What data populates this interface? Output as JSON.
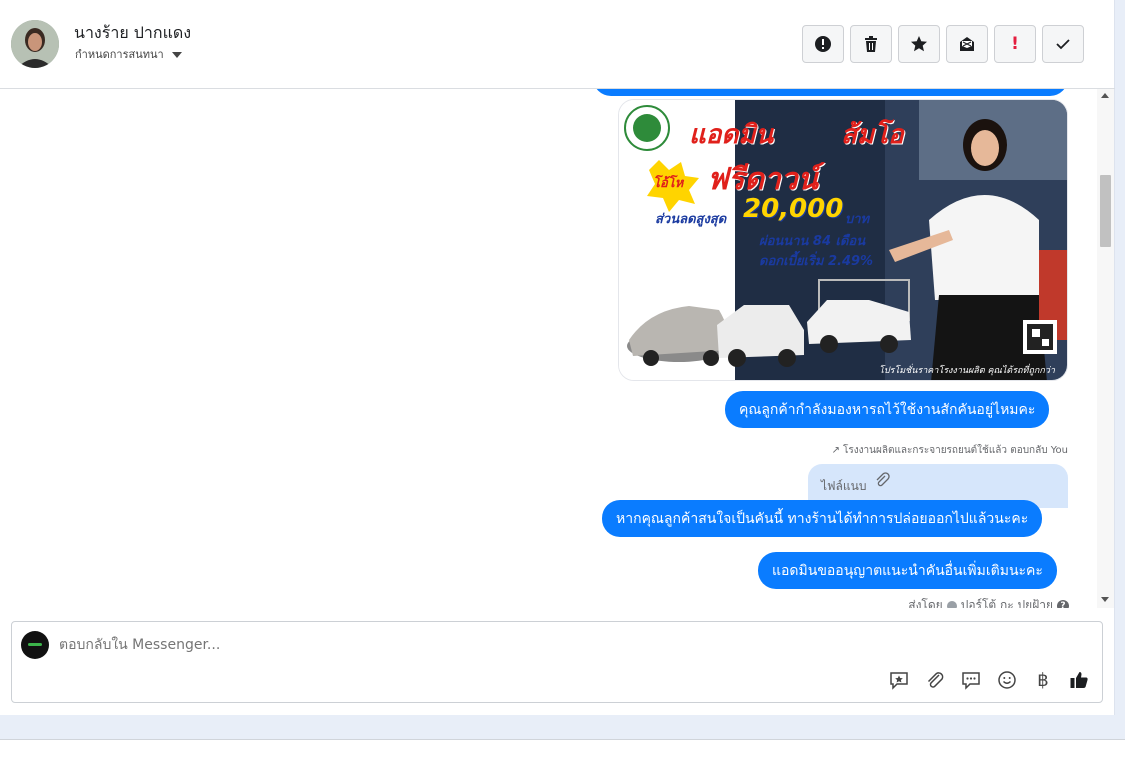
{
  "header": {
    "contact_name": "นางร้าย ปากแดง",
    "assign_label": "กำหนดการสนทนา",
    "toolbar": [
      {
        "name": "report-button",
        "icon": "alert-circle-icon"
      },
      {
        "name": "delete-button",
        "icon": "trash-icon"
      },
      {
        "name": "star-button",
        "icon": "star-icon"
      },
      {
        "name": "mark-unread-button",
        "icon": "envelope-icon"
      },
      {
        "name": "follow-up-button",
        "icon": "exclamation-icon"
      },
      {
        "name": "mark-done-button",
        "icon": "check-icon"
      }
    ]
  },
  "promo_image": {
    "headline_1": "แอดมิน",
    "headline_2": "ส้มโอ",
    "badge": "โอ้โห",
    "free_down": "ฟรีดาวน์",
    "discount_label": "ส่วนลดสูงสุด",
    "discount_amount": "20,000",
    "discount_unit": "บาท",
    "installment": "ผ่อนนาน 84 เดือน",
    "interest": "ดอกเบี้ยเริ่ม 2.49%",
    "footer": "โปรโมชั่นราคาโรงงานผลิต คุณได้รถที่ถูกกว่า"
  },
  "messages": [
    {
      "text": "คุณลูกค้ากำลังมองหารถไว้ใช้งานสักคันอยู่ไหมคะ"
    },
    {
      "text": "หากคุณลูกค้าสนใจเป็นคันนี้ ทางร้านได้ทำการปล่อยออกไปแล้วนะคะ"
    },
    {
      "text": "แอดมินขออนุญาตแนะนำคันอื่นเพิ่มเติมนะคะ"
    }
  ],
  "reply_note": "โรงงานผลิตและกระจายรถยนต์ใช้แล้ว ตอบกลับ You",
  "attachment_label": "ไฟล์แนบ",
  "sent_by": {
    "prefix": "ส่งโดย",
    "name": "ปอร์โต้ กะ ปยฝ้าย"
  },
  "composer": {
    "placeholder": "ตอบกลับใน Messenger...",
    "tools": [
      "saved-reply-icon",
      "paperclip-icon",
      "chat-bubbles-icon",
      "emoji-icon",
      "baht-icon",
      "thumbs-up-icon"
    ],
    "baht_symbol": "฿"
  },
  "colors": {
    "bubble": "#0a7cff",
    "attachment_bubble": "#d6e6fb",
    "promo_red": "#e0201b",
    "promo_yellow": "#ffd400"
  }
}
